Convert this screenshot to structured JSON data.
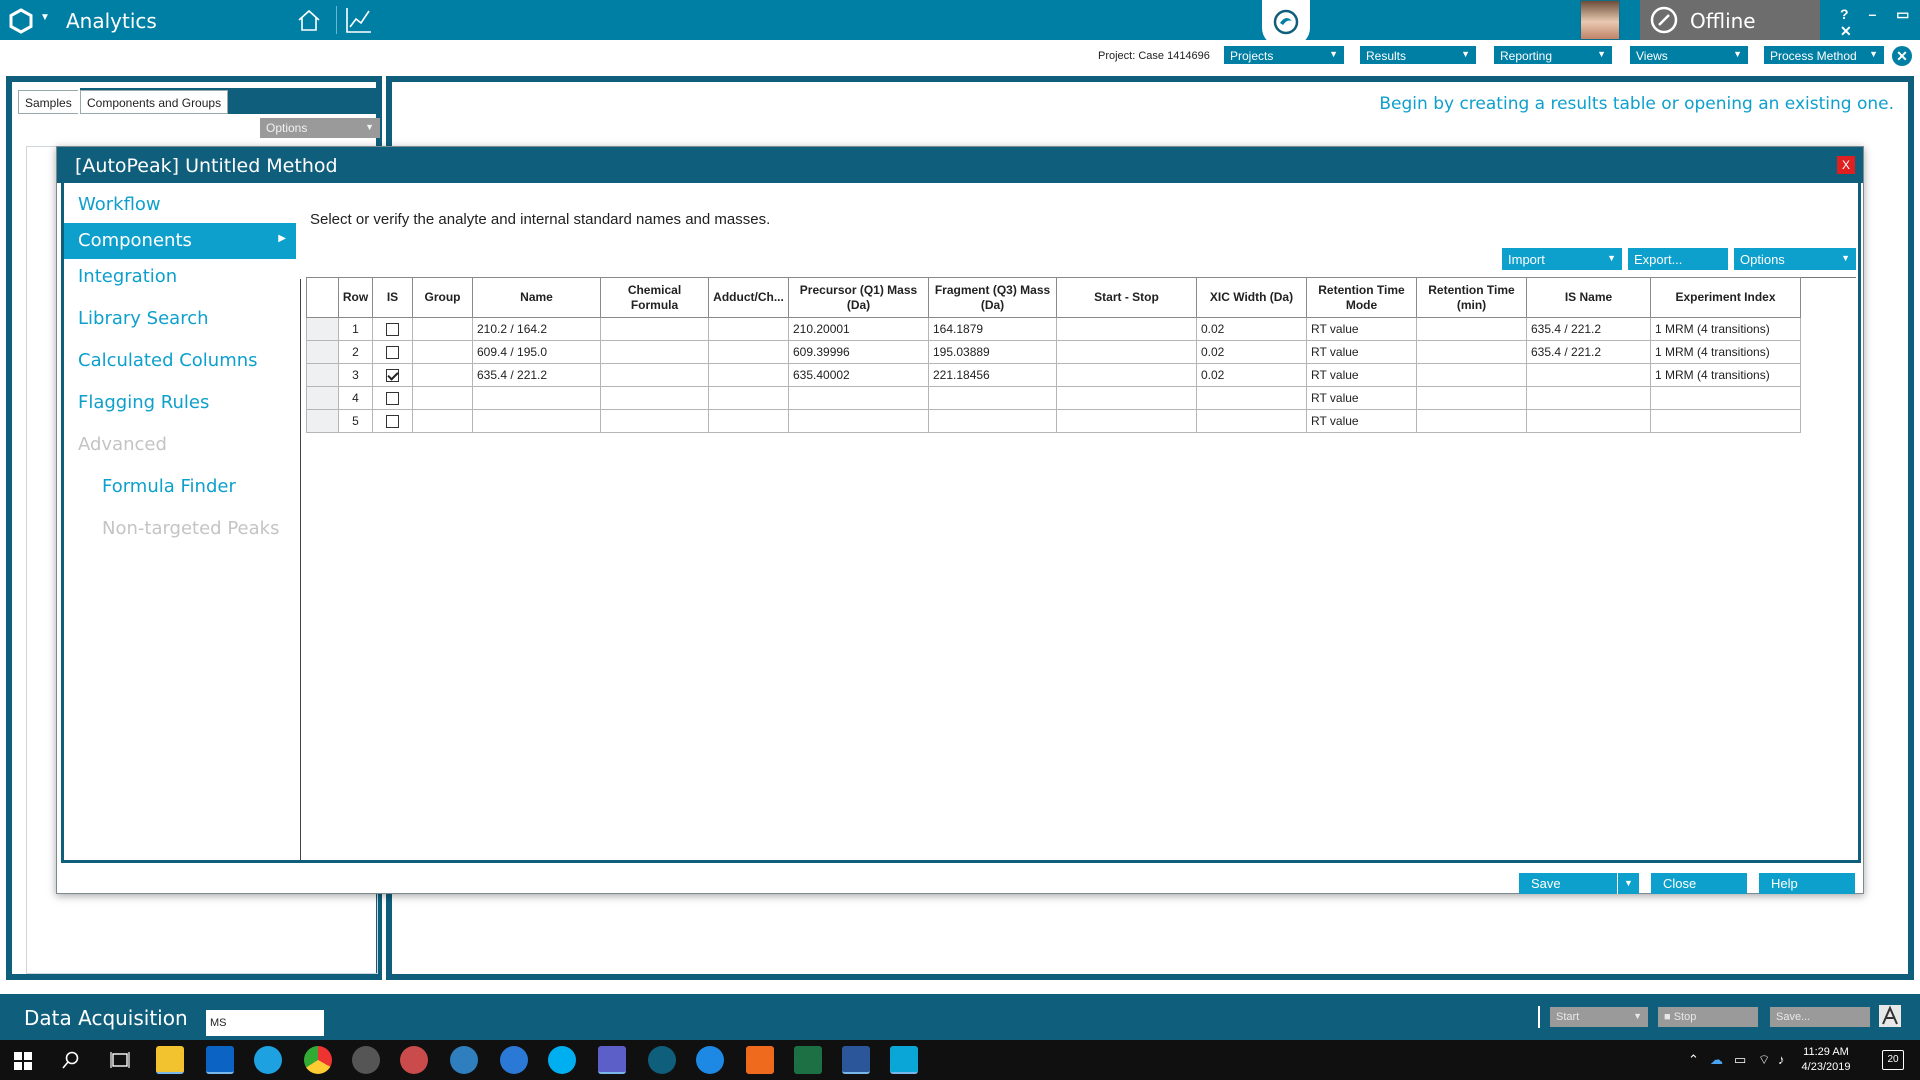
{
  "app": {
    "title": "Analytics",
    "status": "Offline",
    "window_controls": "? – ▭ ✕"
  },
  "toolbar": {
    "project": "Project: Case 1414696",
    "dropdowns": [
      "Projects",
      "Results",
      "Reporting",
      "Views",
      "Process Method"
    ],
    "close_glyph": "✕"
  },
  "left_panel": {
    "tabs": [
      "Samples",
      "Components and Groups"
    ],
    "options_label": "Options"
  },
  "right_panel": {
    "message": "Begin by creating a results table or opening an existing one."
  },
  "dialog": {
    "title": "[AutoPeak] Untitled Method",
    "close_label": "X",
    "instruction": "Select or verify the analyte and internal standard names and masses.",
    "nav": [
      {
        "label": "Workflow",
        "state": "normal"
      },
      {
        "label": "Components",
        "state": "active"
      },
      {
        "label": "Integration",
        "state": "normal"
      },
      {
        "label": "Library Search",
        "state": "normal"
      },
      {
        "label": "Calculated Columns",
        "state": "normal"
      },
      {
        "label": "Flagging Rules",
        "state": "normal"
      },
      {
        "label": "Advanced",
        "state": "disabled"
      },
      {
        "label": "Formula Finder",
        "state": "sub"
      },
      {
        "label": "Non-targeted Peaks",
        "state": "sub-disabled"
      }
    ],
    "buttons": {
      "import": "Import",
      "export": "Export...",
      "options": "Options"
    },
    "table": {
      "headers": [
        "Row",
        "IS",
        "Group",
        "Name",
        "Chemical Formula",
        "Adduct/Ch...",
        "Precursor (Q1) Mass (Da)",
        "Fragment (Q3) Mass (Da)",
        "Start - Stop",
        "XIC Width (Da)",
        "Retention Time Mode",
        "Retention Time (min)",
        "IS Name",
        "Experiment Index"
      ],
      "rows": [
        {
          "row": "1",
          "is": false,
          "group": "",
          "name": "210.2 / 164.2",
          "formula": "",
          "adduct": "",
          "q1": "210.20001",
          "q3": "164.1879",
          "start_stop": "",
          "xic": "0.02",
          "rt_mode": "RT value",
          "rt": "",
          "is_name": "635.4 / 221.2",
          "exp": "1 MRM (4 transitions)"
        },
        {
          "row": "2",
          "is": false,
          "group": "",
          "name": "609.4 / 195.0",
          "formula": "",
          "adduct": "",
          "q1": "609.39996",
          "q3": "195.03889",
          "start_stop": "",
          "xic": "0.02",
          "rt_mode": "RT value",
          "rt": "",
          "is_name": "635.4 / 221.2",
          "exp": "1 MRM (4 transitions)"
        },
        {
          "row": "3",
          "is": true,
          "group": "",
          "name": "635.4 / 221.2",
          "formula": "",
          "adduct": "",
          "q1": "635.40002",
          "q3": "221.18456",
          "start_stop": "",
          "xic": "0.02",
          "rt_mode": "RT value",
          "rt": "",
          "is_name": "",
          "exp": "1 MRM (4 transitions)"
        },
        {
          "row": "4",
          "is": false,
          "group": "",
          "name": "",
          "formula": "",
          "adduct": "",
          "q1": "",
          "q3": "",
          "start_stop": "",
          "xic": "",
          "rt_mode": "RT value",
          "rt": "",
          "is_name": "",
          "exp": ""
        },
        {
          "row": "5",
          "is": false,
          "group": "",
          "name": "",
          "formula": "",
          "adduct": "",
          "q1": "",
          "q3": "",
          "start_stop": "",
          "xic": "",
          "rt_mode": "RT value",
          "rt": "",
          "is_name": "",
          "exp": ""
        }
      ]
    },
    "footer": {
      "save": "Save",
      "close": "Close",
      "help": "Help"
    }
  },
  "acquisition": {
    "title": "Data Acquisition",
    "ms_value": "MS",
    "start": "Start",
    "stop": "Stop",
    "save": "Save..."
  },
  "taskbar": {
    "apps": [
      "windows-start",
      "search",
      "task-view",
      "file-explorer",
      "outlook",
      "internet-explorer",
      "chrome",
      "settings",
      "paint",
      "globe",
      "skype-business",
      "skype",
      "teams",
      "sciex-app",
      "edge",
      "brave",
      "excel",
      "word",
      "sciex-os"
    ],
    "time": "11:29 AM",
    "date": "4/23/2019",
    "notifications": "20"
  },
  "colors": {
    "brand": "#007fa5",
    "dark_teal": "#0f5f7c",
    "accent": "#0ea0cc",
    "gray_control": "#9a9a9a",
    "offline_bg": "#6d6d6d",
    "close_red": "#e02020"
  }
}
